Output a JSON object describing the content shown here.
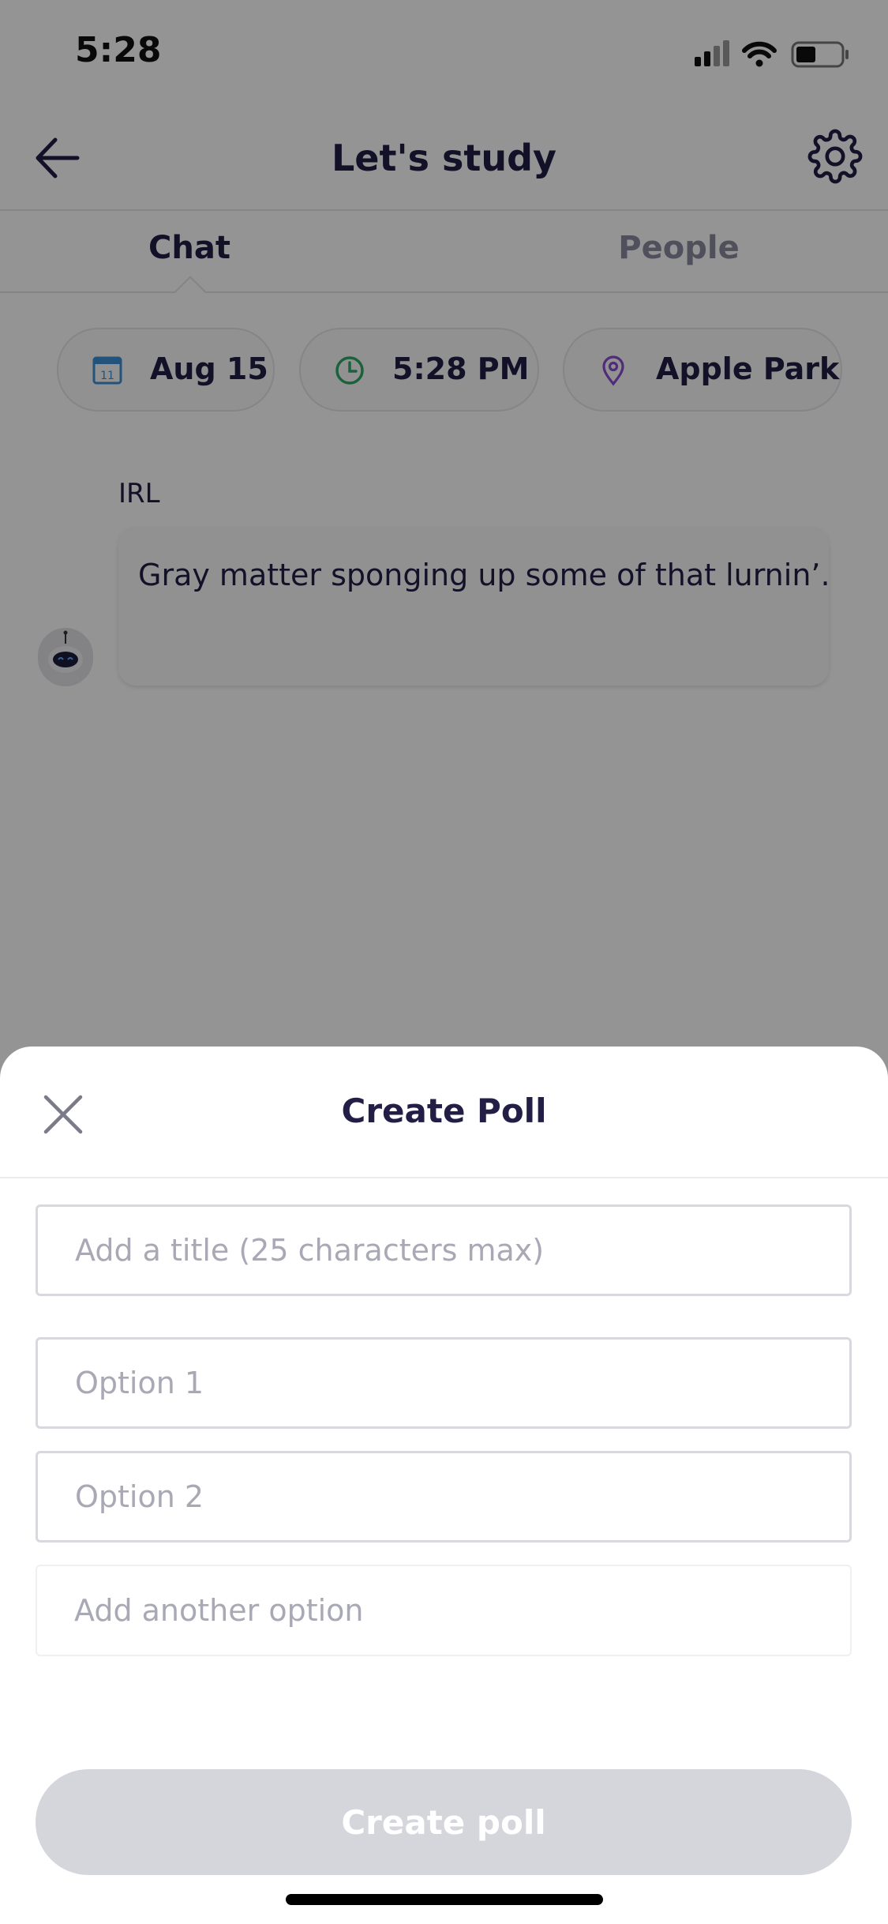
{
  "status_bar": {
    "time": "5:28"
  },
  "header": {
    "title": "Let's study"
  },
  "tabs": [
    {
      "label": "Chat"
    },
    {
      "label": "People"
    }
  ],
  "chips": [
    {
      "label": "Aug 15",
      "icon": "calendar-icon",
      "color": "#3b8fd8",
      "icon_text": "11"
    },
    {
      "label": "5:28 PM",
      "icon": "clock-icon",
      "color": "#2fa866"
    },
    {
      "label": "Apple Park",
      "icon": "location-pin-icon",
      "color": "#8b4cd4"
    }
  ],
  "message": {
    "sender": "IRL",
    "text": "Gray matter sponging up some of that lurnin’."
  },
  "sheet": {
    "title": "Create Poll",
    "title_placeholder": "Add a title (25 characters max)",
    "option1_placeholder": "Option 1",
    "option2_placeholder": "Option 2",
    "add_option_placeholder": "Add another option",
    "submit_label": "Create poll"
  }
}
